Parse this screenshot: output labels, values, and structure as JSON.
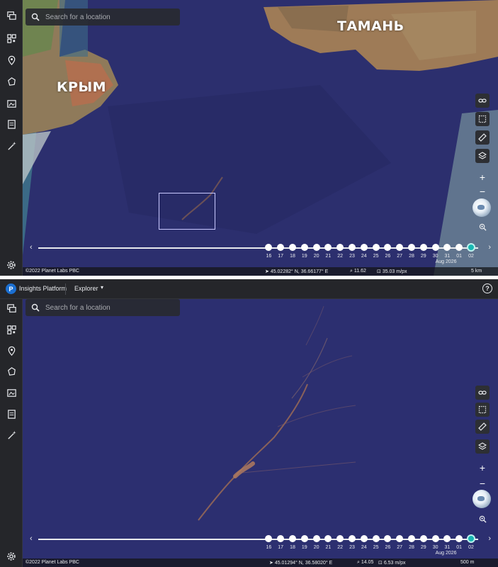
{
  "colors": {
    "sea": "#2c2f6e",
    "sea_dark": "#262962",
    "land_tan": "#a07a55",
    "accent_teal": "#18b7b2",
    "sidebar": "#25262a"
  },
  "top": {
    "search": {
      "placeholder": "Search for a location"
    },
    "labels": {
      "crimea": "КРЫМ",
      "taman": "ТАМАНЬ"
    },
    "timeline": {
      "days": [
        "16",
        "17",
        "18",
        "19",
        "20",
        "21",
        "22",
        "23",
        "24",
        "25",
        "26",
        "27",
        "28",
        "29",
        "30",
        "31",
        "01",
        "02"
      ],
      "month": "Aug 2026",
      "active_index": 17
    },
    "status": {
      "copyright": "©2022 Planet Labs PBC",
      "coords": "45.02282° N, 36.66177° E",
      "zoom": "11.62",
      "resolution": "35.03 m/px",
      "scale": "5 km"
    }
  },
  "bottom": {
    "app": {
      "title": "Insights Platform",
      "section": "Explorer",
      "logo": "P",
      "help": "?"
    },
    "search": {
      "placeholder": "Search for a location"
    },
    "timeline": {
      "days": [
        "16",
        "17",
        "18",
        "19",
        "20",
        "21",
        "22",
        "23",
        "24",
        "25",
        "26",
        "27",
        "28",
        "29",
        "30",
        "31",
        "01",
        "02"
      ],
      "month": "Aug 2026",
      "active_index": 17
    },
    "status": {
      "copyright": "©2022 Planet Labs PBC",
      "coords": "45.01294° N, 36.58020° E",
      "zoom": "14.05",
      "resolution": "6.53 m/px",
      "scale": "500 m"
    }
  },
  "icons": {
    "sidebar": [
      "layers-stack-icon",
      "grid-qr-icon",
      "location-pin-icon",
      "polygon-icon",
      "image-pin-icon",
      "document-icon",
      "magic-wand-icon"
    ],
    "tools": [
      "link-icon",
      "select-area-icon",
      "ruler-icon",
      "layers-icon"
    ],
    "zoom_in": "+",
    "zoom_out": "−"
  }
}
